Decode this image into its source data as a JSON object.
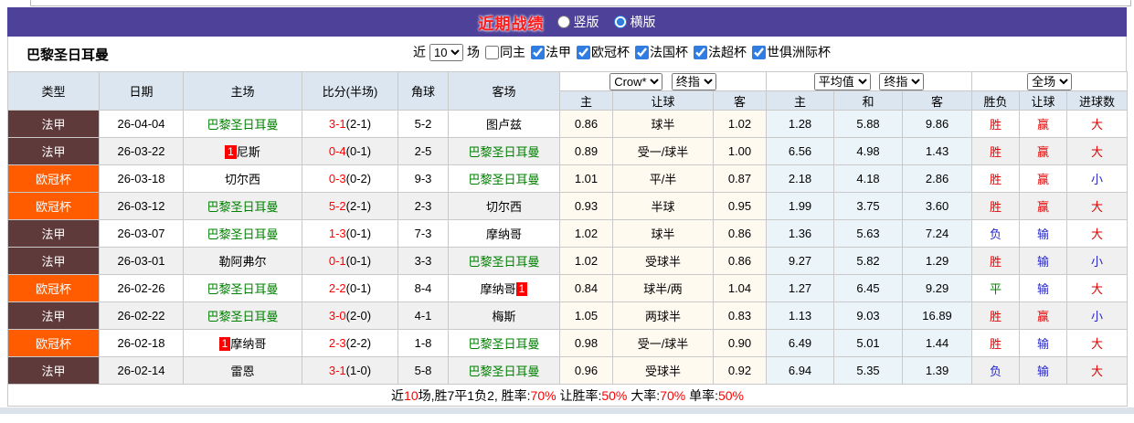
{
  "header_bar": {
    "title": "近期战绩",
    "radio_vertical": "竖版",
    "radio_horizontal": "横版"
  },
  "filter_bar": {
    "team": "巴黎圣日耳曼",
    "near_label": "近",
    "matches_value": "10",
    "matches_unit": "场",
    "same_home_label": "同主",
    "leagues": [
      "法甲",
      "欧冠杯",
      "法国杯",
      "法超杯",
      "世俱洲际杯"
    ]
  },
  "table": {
    "col_headers": {
      "type": "类型",
      "date": "日期",
      "home": "主场",
      "score": "比分(半场)",
      "corner": "角球",
      "away": "客场"
    },
    "selects": {
      "odds_company": "Crow*",
      "odds_final": "终指",
      "average": "平均值",
      "average_final": "终指",
      "full_match": "全场"
    },
    "sub_headers": [
      "主",
      "让球",
      "客",
      "主",
      "和",
      "客",
      "胜负",
      "让球",
      "进球数"
    ],
    "rows": [
      {
        "type": "法甲",
        "date": "26-04-04",
        "home": {
          "name": "巴黎圣日耳曼",
          "psg": true
        },
        "score": "3-1",
        "half": "(2-1)",
        "corner": "5-2",
        "away": {
          "name": "图卢兹",
          "psg": false
        },
        "odds": [
          "0.86",
          "球半",
          "1.02"
        ],
        "avg": [
          "1.28",
          "5.88",
          "9.86"
        ],
        "results": [
          {
            "t": "胜",
            "c": "red"
          },
          {
            "t": "赢",
            "c": "red"
          },
          {
            "t": "大",
            "c": "red"
          }
        ]
      },
      {
        "type": "法甲",
        "date": "26-03-22",
        "home": {
          "name": "尼斯",
          "psg": false,
          "badge": "1",
          "badge_pos": "before"
        },
        "score": "0-4",
        "half": "(0-1)",
        "corner": "2-5",
        "away": {
          "name": "巴黎圣日耳曼",
          "psg": true
        },
        "odds": [
          "0.89",
          "受一/球半",
          "1.00"
        ],
        "avg": [
          "6.56",
          "4.98",
          "1.43"
        ],
        "results": [
          {
            "t": "胜",
            "c": "red"
          },
          {
            "t": "赢",
            "c": "red"
          },
          {
            "t": "大",
            "c": "red"
          }
        ]
      },
      {
        "type": "欧冠杯",
        "date": "26-03-18",
        "home": {
          "name": "切尔西",
          "psg": false
        },
        "score": "0-3",
        "half": "(0-2)",
        "corner": "9-3",
        "away": {
          "name": "巴黎圣日耳曼",
          "psg": true
        },
        "odds": [
          "1.01",
          "平/半",
          "0.87"
        ],
        "avg": [
          "2.18",
          "4.18",
          "2.86"
        ],
        "results": [
          {
            "t": "胜",
            "c": "red"
          },
          {
            "t": "赢",
            "c": "red"
          },
          {
            "t": "小",
            "c": "blue"
          }
        ]
      },
      {
        "type": "欧冠杯",
        "date": "26-03-12",
        "home": {
          "name": "巴黎圣日耳曼",
          "psg": true
        },
        "score": "5-2",
        "half": "(2-1)",
        "corner": "2-3",
        "away": {
          "name": "切尔西",
          "psg": false
        },
        "odds": [
          "0.93",
          "半球",
          "0.95"
        ],
        "avg": [
          "1.99",
          "3.75",
          "3.60"
        ],
        "results": [
          {
            "t": "胜",
            "c": "red"
          },
          {
            "t": "赢",
            "c": "red"
          },
          {
            "t": "大",
            "c": "red"
          }
        ]
      },
      {
        "type": "法甲",
        "date": "26-03-07",
        "home": {
          "name": "巴黎圣日耳曼",
          "psg": true
        },
        "score": "1-3",
        "half": "(0-1)",
        "corner": "7-3",
        "away": {
          "name": "摩纳哥",
          "psg": false
        },
        "odds": [
          "1.02",
          "球半",
          "0.86"
        ],
        "avg": [
          "1.36",
          "5.63",
          "7.24"
        ],
        "results": [
          {
            "t": "负",
            "c": "blue"
          },
          {
            "t": "输",
            "c": "blue"
          },
          {
            "t": "大",
            "c": "red"
          }
        ]
      },
      {
        "type": "法甲",
        "date": "26-03-01",
        "home": {
          "name": "勒阿弗尔",
          "psg": false
        },
        "score": "0-1",
        "half": "(0-1)",
        "corner": "3-3",
        "away": {
          "name": "巴黎圣日耳曼",
          "psg": true
        },
        "odds": [
          "1.02",
          "受球半",
          "0.86"
        ],
        "avg": [
          "9.27",
          "5.82",
          "1.29"
        ],
        "results": [
          {
            "t": "胜",
            "c": "red"
          },
          {
            "t": "输",
            "c": "blue"
          },
          {
            "t": "小",
            "c": "blue"
          }
        ]
      },
      {
        "type": "欧冠杯",
        "date": "26-02-26",
        "home": {
          "name": "巴黎圣日耳曼",
          "psg": true
        },
        "score": "2-2",
        "half": "(0-1)",
        "corner": "8-4",
        "away": {
          "name": "摩纳哥",
          "psg": false,
          "badge": "1",
          "badge_pos": "after"
        },
        "odds": [
          "0.84",
          "球半/两",
          "1.04"
        ],
        "avg": [
          "1.27",
          "6.45",
          "9.29"
        ],
        "results": [
          {
            "t": "平",
            "c": "green"
          },
          {
            "t": "输",
            "c": "blue"
          },
          {
            "t": "大",
            "c": "red"
          }
        ]
      },
      {
        "type": "法甲",
        "date": "26-02-22",
        "home": {
          "name": "巴黎圣日耳曼",
          "psg": true
        },
        "score": "3-0",
        "half": "(2-0)",
        "corner": "4-1",
        "away": {
          "name": "梅斯",
          "psg": false
        },
        "odds": [
          "1.05",
          "两球半",
          "0.83"
        ],
        "avg": [
          "1.13",
          "9.03",
          "16.89"
        ],
        "results": [
          {
            "t": "胜",
            "c": "red"
          },
          {
            "t": "赢",
            "c": "red"
          },
          {
            "t": "小",
            "c": "blue"
          }
        ]
      },
      {
        "type": "欧冠杯",
        "date": "26-02-18",
        "home": {
          "name": "摩纳哥",
          "psg": false,
          "badge": "1",
          "badge_pos": "before"
        },
        "score": "2-3",
        "half": "(2-2)",
        "corner": "1-8",
        "away": {
          "name": "巴黎圣日耳曼",
          "psg": true
        },
        "odds": [
          "0.98",
          "受一/球半",
          "0.90"
        ],
        "avg": [
          "6.49",
          "5.01",
          "1.44"
        ],
        "results": [
          {
            "t": "胜",
            "c": "red"
          },
          {
            "t": "输",
            "c": "blue"
          },
          {
            "t": "大",
            "c": "red"
          }
        ]
      },
      {
        "type": "法甲",
        "date": "26-02-14",
        "home": {
          "name": "雷恩",
          "psg": false
        },
        "score": "3-1",
        "half": "(1-0)",
        "corner": "5-8",
        "away": {
          "name": "巴黎圣日耳曼",
          "psg": true
        },
        "odds": [
          "0.96",
          "受球半",
          "0.92"
        ],
        "avg": [
          "6.94",
          "5.35",
          "1.39"
        ],
        "results": [
          {
            "t": "负",
            "c": "blue"
          },
          {
            "t": "输",
            "c": "blue"
          },
          {
            "t": "大",
            "c": "red"
          }
        ]
      }
    ]
  },
  "footer": {
    "segments": [
      {
        "t": "近",
        "c": "black"
      },
      {
        "t": "10",
        "c": "red"
      },
      {
        "t": "场,胜7平1负2, 胜率:",
        "c": "black"
      },
      {
        "t": "70%",
        "c": "red"
      },
      {
        "t": " 让胜率:",
        "c": "black"
      },
      {
        "t": "50%",
        "c": "red"
      },
      {
        "t": " 大率:",
        "c": "black"
      },
      {
        "t": "70%",
        "c": "red"
      },
      {
        "t": " 单率:",
        "c": "black"
      },
      {
        "t": "50%",
        "c": "red"
      }
    ]
  },
  "colors": {
    "title_bar_bg": "#4e4199",
    "title_text": "#ff1a1a",
    "header_cell_bg": "#dce6f1",
    "odds_bg": "#fffaf0",
    "avg_bg": "#ebf5f9",
    "alt_row_bg": "#f0f0f0",
    "psg_green": "#008000",
    "score_red": "#ff0000",
    "accent_red": "#ff0000",
    "type": {
      "法甲": "#5e3a3a",
      "欧冠杯": "#ff5c00"
    },
    "result": {
      "red": "#e60000",
      "blue": "#2626cc",
      "green": "#008000"
    }
  }
}
